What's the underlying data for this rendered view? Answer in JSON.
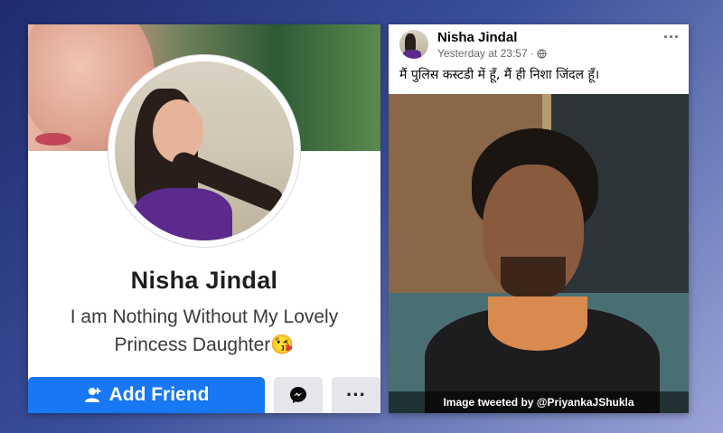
{
  "profile": {
    "name": "Nisha Jindal",
    "bio": "I am Nothing Without My Lovely Princess Daughter😘",
    "add_friend_label": "Add Friend",
    "more_label": "···"
  },
  "post": {
    "author": "Nisha Jindal",
    "timestamp": "Yesterday at 23:57",
    "separator": "·",
    "privacy_icon": "globe-icon",
    "more_label": "···",
    "text": "मैं पुलिस कस्टडी में हूँ, मैं ही निशा जिंदल हूँ।",
    "caption": "Image tweeted by @PriyankaJShukla"
  },
  "colors": {
    "facebook_blue": "#1877f2",
    "button_gray": "#e4e6eb",
    "text_dark": "#1c1e21",
    "meta_gray": "#65676b"
  }
}
